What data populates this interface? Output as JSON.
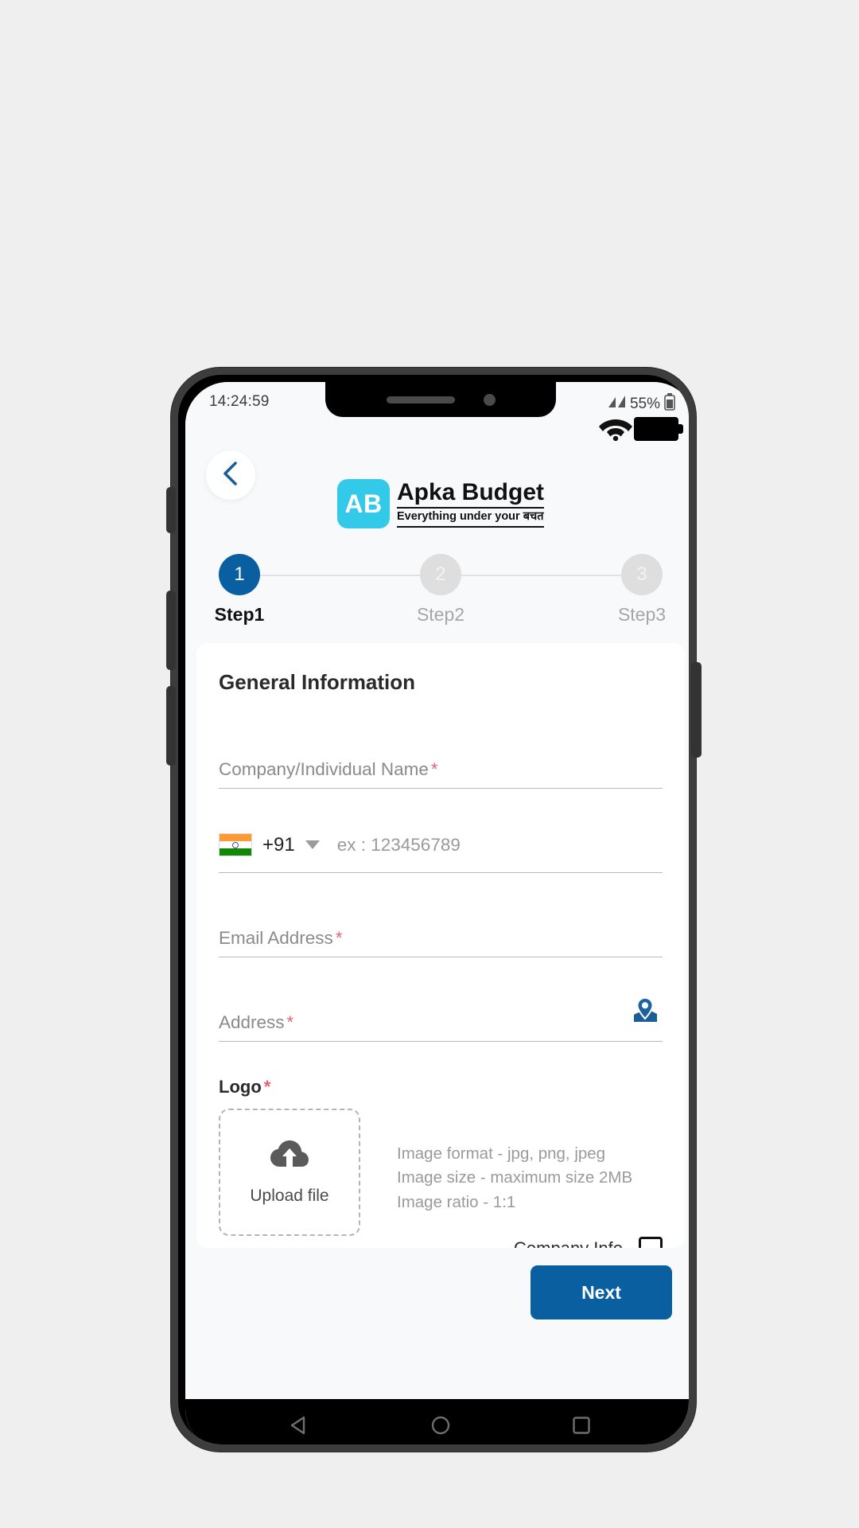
{
  "status_bar": {
    "time": "14:24:59",
    "battery_percent": "55%",
    "icons": [
      "signal-icon",
      "wifi-icon",
      "battery-icon"
    ]
  },
  "header": {
    "back_icon": "chevron-left-icon",
    "logo_mark_text": "AB",
    "logo_title": "Apka Budget",
    "logo_tagline": "Everything under your बचत",
    "logo_mark_color": "#33c9e8"
  },
  "stepper": {
    "accent_color": "#0a5fa0",
    "inactive_color": "#dedede",
    "steps": [
      {
        "number": "1",
        "label": "Step1",
        "active": true
      },
      {
        "number": "2",
        "label": "Step2",
        "active": false
      },
      {
        "number": "3",
        "label": "Step3",
        "active": false
      }
    ]
  },
  "form": {
    "section_title": "General Information",
    "required_mark": "*",
    "required_color": "#e8616f",
    "fields": {
      "company_name": {
        "label": "Company/Individual Name",
        "value": ""
      },
      "phone": {
        "flag": "india-flag-icon",
        "dial_code": "+91",
        "placeholder": "ex : 123456789",
        "value": ""
      },
      "email": {
        "label": "Email Address",
        "value": ""
      },
      "address": {
        "label": "Address",
        "value": "",
        "icon": "map-pin-icon"
      }
    },
    "logo_upload": {
      "label": "Logo",
      "upload_icon": "cloud-upload-icon",
      "upload_label": "Upload file",
      "hints": [
        "Image format - jpg, png, jpeg",
        "Image size - maximum size 2MB",
        "Image ratio - 1:1"
      ]
    },
    "clipped_footer_text": "Company Info"
  },
  "footer": {
    "next_label": "Next",
    "next_color": "#0a5fa0"
  },
  "nav_bar": {
    "back_icon": "triangle-back-icon",
    "home_icon": "circle-home-icon",
    "recents_icon": "square-recents-icon"
  }
}
